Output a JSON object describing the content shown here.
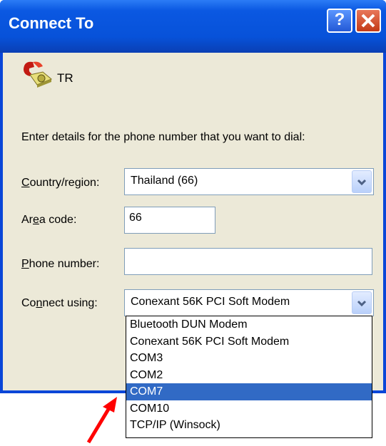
{
  "window": {
    "title": "Connect To"
  },
  "connection": {
    "name": "TR"
  },
  "prompt": "Enter details for the phone number that you want to dial:",
  "fields": {
    "country_label": {
      "mnemonic": "C",
      "rest": "ountry/region:"
    },
    "country_value": "Thailand (66)",
    "area_label": {
      "before": "Ar",
      "mnemonic": "e",
      "after": "a code:"
    },
    "area_value": "66",
    "phone_label": {
      "mnemonic": "P",
      "rest": "hone number:"
    },
    "phone_value": "",
    "connect_label": {
      "before": "Co",
      "mnemonic": "n",
      "after": "nect using:"
    },
    "connect_value": "Conexant 56K PCI Soft Modem"
  },
  "dropdown": {
    "options": [
      "Bluetooth DUN Modem",
      "Conexant 56K PCI Soft Modem",
      "COM3",
      "COM2",
      "COM7",
      "COM10",
      "TCP/IP (Winsock)"
    ],
    "highlighted": "COM7"
  },
  "colors": {
    "annotation_arrow": "#ff0000",
    "selection": "#316ac5",
    "titlebar": "#0752d9"
  },
  "icons": [
    "help-icon",
    "close-icon",
    "telephone-icon",
    "dropdown-arrow-icon"
  ]
}
